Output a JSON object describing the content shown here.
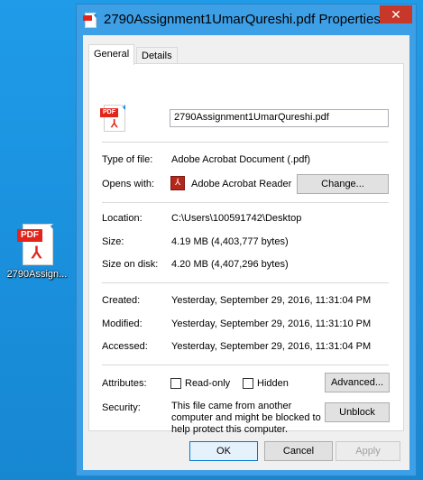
{
  "desktop": {
    "icon_label": "2790Assign...",
    "icon_name": "pdf-file-icon"
  },
  "window": {
    "title": "2790Assignment1UmarQureshi.pdf Properties",
    "close_glyph": "✕"
  },
  "tabs": [
    {
      "label": "General"
    },
    {
      "label": "Details"
    }
  ],
  "general": {
    "file_name": "2790Assignment1UmarQureshi.pdf",
    "type_label": "Type of file:",
    "type_value": "Adobe Acrobat Document (.pdf)",
    "opens_label": "Opens with:",
    "opens_value": "Adobe Acrobat Reader",
    "change_button": "Change...",
    "location_label": "Location:",
    "location_value": "C:\\Users\\100591742\\Desktop",
    "size_label": "Size:",
    "size_value": "4.19 MB (4,403,777 bytes)",
    "size_disk_label": "Size on disk:",
    "size_disk_value": "4.20 MB (4,407,296 bytes)",
    "created_label": "Created:",
    "created_value": "Yesterday, September 29, 2016, 11:31:04 PM",
    "modified_label": "Modified:",
    "modified_value": "Yesterday, September 29, 2016, 11:31:10 PM",
    "accessed_label": "Accessed:",
    "accessed_value": "Yesterday, September 29, 2016, 11:31:04 PM",
    "attributes_label": "Attributes:",
    "readonly_label": "Read-only",
    "readonly_checked": false,
    "hidden_label": "Hidden",
    "hidden_checked": false,
    "advanced_button": "Advanced...",
    "security_label": "Security:",
    "security_text_1": "This file came from another",
    "security_text_2": "computer and might be blocked to",
    "security_text_3": "help protect this computer.",
    "unblock_button": "Unblock"
  },
  "footer": {
    "ok": "OK",
    "cancel": "Cancel",
    "apply": "Apply",
    "apply_enabled": false
  },
  "pdf_tag_text": "PDF",
  "colors": {
    "desktop": "#1a8fdb",
    "window_border": "#3d9fe6",
    "close": "#c7372a",
    "pdf_red": "#e3241b"
  }
}
